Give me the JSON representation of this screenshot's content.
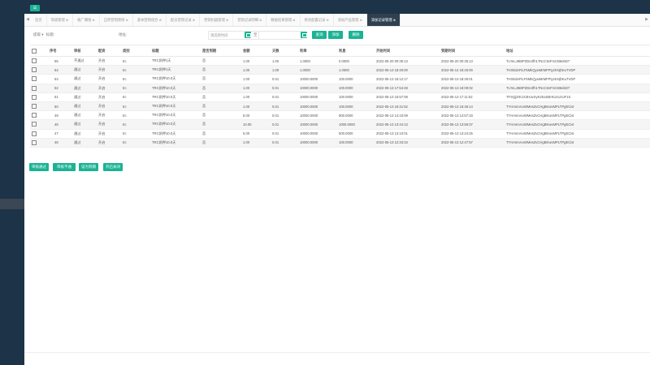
{
  "topbar": {
    "menu_button_label": "☰"
  },
  "tabs": {
    "prev": "◀",
    "next": "▶",
    "items": [
      {
        "label": "首页",
        "closable": false,
        "active": false
      },
      {
        "label": "等级管理",
        "closable": true,
        "active": false
      },
      {
        "label": "推广赚钱",
        "closable": true,
        "active": false
      },
      {
        "label": "自然营销原则",
        "closable": true,
        "active": false
      },
      {
        "label": "基本营销组合",
        "closable": true,
        "active": false
      },
      {
        "label": "配员营销记录",
        "closable": true,
        "active": false
      },
      {
        "label": "营销机器管理",
        "closable": true,
        "active": false
      },
      {
        "label": "营销记录明细",
        "closable": true,
        "active": false
      },
      {
        "label": "数据结果管理",
        "closable": true,
        "active": false
      },
      {
        "label": "修改配置记录",
        "closable": true,
        "active": false
      },
      {
        "label": "添加产品管理",
        "closable": true,
        "active": false
      },
      {
        "label": "添加记录管理",
        "closable": true,
        "active": true
      }
    ]
  },
  "search": {
    "select_value": "提取",
    "select_arrow": "▾",
    "select_hint": "标题:",
    "label_address": "地址:",
    "start_placeholder": "请选择时间",
    "to_label": "至",
    "end_placeholder": "",
    "search_button": "查询",
    "add_button": "添加",
    "delete_button": "删除"
  },
  "table": {
    "columns": [
      "",
      "序号",
      "审核",
      "配资",
      "类别",
      "标题",
      "是否到期",
      "金额",
      "天数",
      "利率",
      "利息",
      "开始时间",
      "到期时间",
      "地址"
    ],
    "rows": [
      {
        "id": "55",
        "status": "不通过",
        "type": "开启",
        "cat": "trc",
        "title": "TRC质押1天",
        "expired": "否",
        "amount": "1.00",
        "days": "1.00",
        "rate": "1.0000",
        "interest": "0.0000",
        "start": "2022-05-20 00:35:13",
        "end": "2022-05-20 00:35:13",
        "addr": "TLYeLJ6BIPZDe3fh1TNcC5vFmCB6ebD7"
      },
      {
        "id": "54",
        "status": "通过",
        "type": "开启",
        "cat": "trc",
        "title": "TRC质押1天",
        "expired": "否",
        "amount": "1.00",
        "days": "1.00",
        "rate": "1.0000",
        "interest": "1.0000",
        "start": "2022-05-13 18:40:00",
        "end": "2022-05-14 18:40:00",
        "addr": "THXEdeFtLF5MkQywMrMFPtyzKNjhKuTVDP"
      },
      {
        "id": "53",
        "status": "通过",
        "type": "开启",
        "cat": "trc",
        "title": "TRC质押10.0天",
        "expired": "否",
        "amount": "1.00",
        "days": "0.01",
        "rate": "10000.0000",
        "interest": "100.0000",
        "start": "2022-05-13 18:12:17",
        "end": "2022-05-13 18:26:01",
        "addr": "THXEdeFtLF5MkQywMrMFPtyzKNjhKuTVDP"
      },
      {
        "id": "52",
        "status": "通过",
        "type": "开启",
        "cat": "trc",
        "title": "TRC质押10.0天",
        "expired": "否",
        "amount": "1.00",
        "days": "0.01",
        "rate": "10000.0000",
        "interest": "100.0000",
        "start": "2022-05-13 17:54:28",
        "end": "2022-05-13 18:09:02",
        "addr": "TLYeLJ6BIPZDe3fh1TNcC5vFmCB6ebD7"
      },
      {
        "id": "51",
        "status": "通过",
        "type": "开启",
        "cat": "trc",
        "title": "TRC质押10.0天",
        "expired": "否",
        "amount": "1.00",
        "days": "0.01",
        "rate": "10000.0000",
        "interest": "100.0000",
        "start": "2022-05-13 16:57:08",
        "end": "2022-05-13 17:11:52",
        "addr": "TFSQjZrK1X3HavXyKzEaSBrKUzUzUF1S"
      },
      {
        "id": "50",
        "status": "通过",
        "type": "开启",
        "cat": "trc",
        "title": "TRC质押10.0天",
        "expired": "否",
        "amount": "1.00",
        "days": "0.01",
        "rate": "10000.0000",
        "interest": "100.0000",
        "start": "2022-05-13 16:31:52",
        "end": "2022-05-13 16:46:14",
        "addr": "TYHAsmAoWMesZvCHgBKwvMPLTPgECisr"
      },
      {
        "id": "49",
        "status": "通过",
        "type": "开启",
        "cat": "trc",
        "title": "TRC质押10.0天",
        "expired": "否",
        "amount": "8.00",
        "days": "0.01",
        "rate": "10000.0000",
        "interest": "800.0000",
        "start": "2022-05-13 14:43:09",
        "end": "2022-05-13 14:57:33",
        "addr": "TYHAsmAoWMesZvCHgBKwvMPLTPgECisr"
      },
      {
        "id": "48",
        "status": "通过",
        "type": "开启",
        "cat": "trc",
        "title": "TRC质押10.0天",
        "expired": "否",
        "amount": "10.00",
        "days": "0.01",
        "rate": "10000.0000",
        "interest": "1000.0000",
        "start": "2022-05-13 13:44:13",
        "end": "2022-05-13 13:58:37",
        "addr": "TYHAsmAoWMesZvCHgBKwvMPLTPgECisr"
      },
      {
        "id": "47",
        "status": "通过",
        "type": "开启",
        "cat": "trc",
        "title": "TRC质押10.0天",
        "expired": "否",
        "amount": "5.00",
        "days": "0.01",
        "rate": "10000.0000",
        "interest": "500.0000",
        "start": "2022-05-13 13:10:01",
        "end": "2022-05-13 13:24:25",
        "addr": "TYHAsmAoWMesZvCHgBKwvMPLTPgECisr"
      },
      {
        "id": "46",
        "status": "通过",
        "type": "开启",
        "cat": "trc",
        "title": "TRC质押10.0天",
        "expired": "否",
        "amount": "1.00",
        "days": "0.01",
        "rate": "10000.0000",
        "interest": "100.0000",
        "start": "2022-05-13 12:33:34",
        "end": "2022-05-13 12:47:57",
        "addr": "TYHAsmAoWMesZvCHgBKwvMPLTPgECisr"
      }
    ]
  },
  "bottom": {
    "btn_approve": "审核通过",
    "btn_reject": "审核不通过",
    "btn_set_expired": "设为到期",
    "btn_toggle": "开启关闭"
  },
  "colors": {
    "accent": "#1ab394",
    "sidebar": "#1d3347",
    "active_tab": "#2f4050"
  }
}
